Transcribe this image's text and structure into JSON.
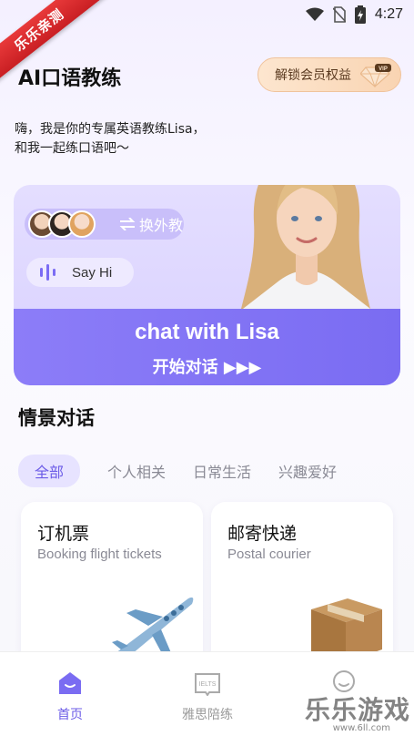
{
  "status_bar": {
    "time": "4:27",
    "icons": [
      "wifi-icon",
      "no-sim-icon",
      "battery-icon"
    ]
  },
  "corner_badge": "乐乐亲测",
  "header": {
    "title": "AI口语教练",
    "vip_label": "解锁会员权益",
    "vip_tag": "VIP"
  },
  "greeting": {
    "line1": "嗨，我是你的专属英语教练Lisa，",
    "line2": "和我一起练口语吧～"
  },
  "hero": {
    "switch_label": "换外教",
    "say_hi": "Say Hi",
    "title": "chat with Lisa",
    "subtitle": "开始对话 ▶▶▶"
  },
  "scenes_section": {
    "title": "情景对话",
    "tabs": [
      "全部",
      "个人相关",
      "日常生活",
      "兴趣爱好"
    ],
    "active_tab": 0,
    "cards": [
      {
        "title": "订机票",
        "subtitle": "Booking flight tickets",
        "icon": "airplane-icon"
      },
      {
        "title": "邮寄快递",
        "subtitle": "Postal courier",
        "icon": "package-icon"
      }
    ]
  },
  "bottom_nav": [
    {
      "label": "首页",
      "icon": "home-icon",
      "active": true
    },
    {
      "label": "雅思陪练",
      "icon": "ielts-book-icon",
      "active": false
    },
    {
      "label": "",
      "icon": "profile-icon",
      "active": false
    }
  ],
  "watermark": {
    "text": "乐乐游戏",
    "url": "www.6ll.com"
  },
  "colors": {
    "accent": "#7a6cf2",
    "vip": "#f9d4b2",
    "badge": "#d62a2d"
  }
}
